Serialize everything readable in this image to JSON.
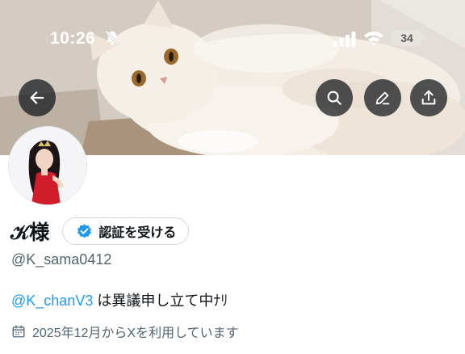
{
  "status_bar": {
    "time": "10:26",
    "battery": "34"
  },
  "header": {
    "back_icon": "arrow-left-icon",
    "search_icon": "search-icon",
    "edit_icon": "pencil-icon",
    "share_icon": "share-upload-icon"
  },
  "profile": {
    "display_name": "𝒦様",
    "verify_button_label": "認証を受ける",
    "handle": "@K_sama0412",
    "bio_mention": "@K_chanV3",
    "bio_text": " は異議申し立て中ﾅﾘ",
    "joined_text": "2025年12月からXを利用しています"
  },
  "colors": {
    "accent": "#1d9bf0",
    "text_primary": "#0f1419",
    "text_secondary": "#536471",
    "button_overlay": "#0f1419"
  }
}
